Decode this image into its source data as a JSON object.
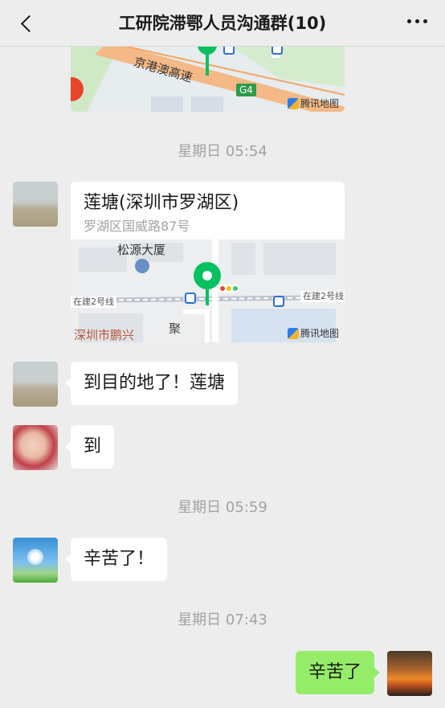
{
  "header": {
    "title": "工研院滞鄂人员沟通群(10)"
  },
  "map_top": {
    "highway_label": "京港澳高速",
    "road_badge": "G4",
    "provider": "腾讯地图"
  },
  "times": [
    "星期日 05:54",
    "星期日 05:59",
    "星期日 07:43"
  ],
  "location_message": {
    "title": "莲塘(深圳市罗湖区)",
    "address": "罗湖区国威路87号",
    "map": {
      "building_label": "松源大厦",
      "line_label_left": "在建2号线",
      "line_label_right": "在建2号线",
      "area_label": "深圳市鹏兴",
      "vertical_label": "聚",
      "provider": "腾讯地图"
    }
  },
  "messages": [
    {
      "side": "left",
      "text": "到目的地了！莲塘"
    },
    {
      "side": "left",
      "text": "到"
    },
    {
      "side": "left",
      "text": "辛苦了！"
    },
    {
      "side": "right",
      "text": "辛苦了"
    }
  ],
  "colors": {
    "background": "#ededed",
    "self_bubble": "#95ec69",
    "other_bubble": "#ffffff",
    "pin": "#07c160",
    "timestamp": "#a3a3a3"
  }
}
